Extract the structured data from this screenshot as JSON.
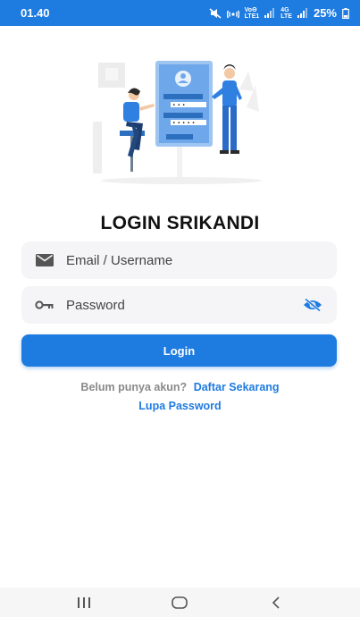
{
  "status_bar": {
    "time": "01.40",
    "network_top": "VoΘ",
    "network_bottom": "LTE1",
    "network2_top": "4G",
    "network2_bottom": "LTE",
    "battery": "25%",
    "icons": [
      "mute-icon",
      "hotspot-icon",
      "signal-icon",
      "battery-icon"
    ]
  },
  "login": {
    "title": "LOGIN SRIKANDI",
    "email_placeholder": "Email / Username",
    "password_placeholder": "Password",
    "button_label": "Login",
    "register_prompt": "Belum punya akun?",
    "register_link": "Daftar Sekarang",
    "forgot_link": "Lupa Password"
  },
  "colors": {
    "accent": "#1e7be0",
    "field_bg": "#f5f5f7",
    "title": "#111111",
    "muted": "#8a8a8a"
  },
  "nav": {
    "icons": [
      "recent-apps-icon",
      "home-icon",
      "back-icon"
    ]
  }
}
